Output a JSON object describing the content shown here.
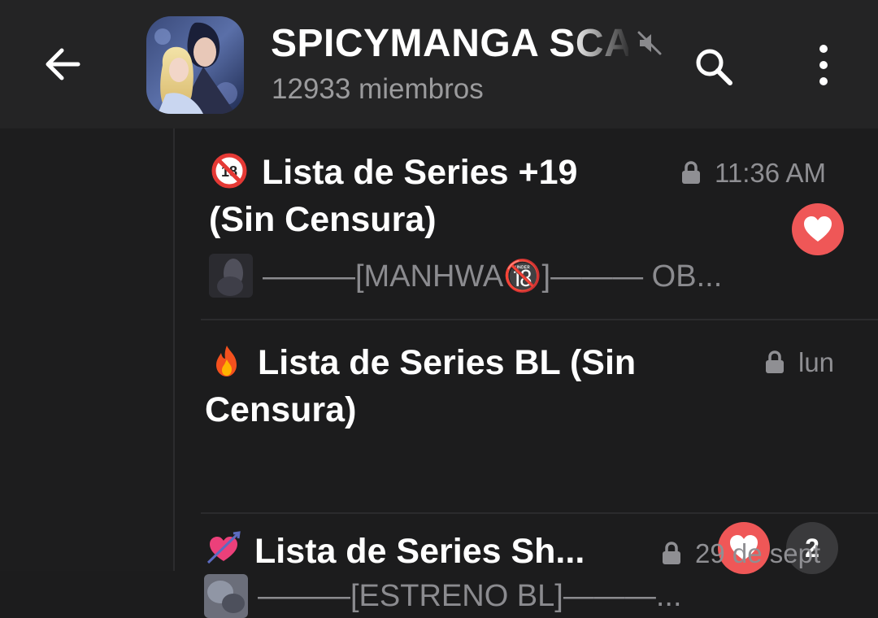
{
  "header": {
    "title": "SPICYMANGA SCA",
    "subtitle": "12933 miembros",
    "icons": {
      "back": "arrow-left-icon",
      "mute": "mute-icon",
      "search": "search-icon",
      "menu": "more-vertical-icon"
    }
  },
  "topics": [
    {
      "emoji": "no-under-18-icon",
      "title_line1": "Lista de Series +19",
      "title_line2": "(Sin Censura)",
      "time": "11:36 AM",
      "preview": "———[MANHWA🔞]——— OB...",
      "reaction": "heart-icon"
    },
    {
      "emoji": "fire-icon",
      "title_line1": "Lista de Series BL (Sin",
      "title_line2": "Censura)",
      "time": "lun",
      "preview": "———[ESTRENO BL]———...",
      "reaction": "heart-icon",
      "unread": "2"
    },
    {
      "emoji": "heart-arrow-icon",
      "title_line1": "Lista de Series Sh...",
      "time": "29 de sept"
    }
  ],
  "colors": {
    "background": "#1c1c1d",
    "header": "#242425",
    "reaction": "#ef5757",
    "muted_text": "#8f8f93"
  }
}
